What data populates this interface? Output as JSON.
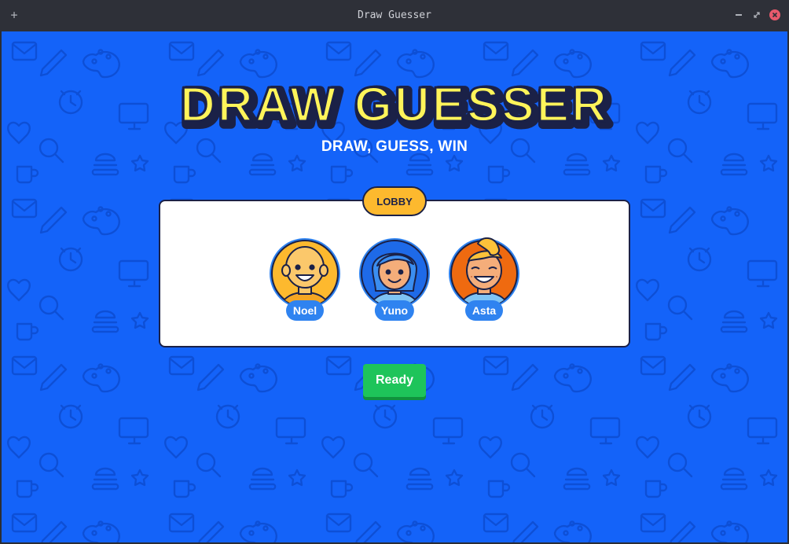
{
  "window": {
    "title": "Draw Guesser",
    "controls": [
      "add-icon",
      "minimize-icon",
      "maximize-icon",
      "close-icon"
    ]
  },
  "app": {
    "logo_text": "DRAW GUESSER",
    "tagline": "DRAW, GUESS, WIN",
    "colors": {
      "background": "#1463f9",
      "logo_fill": "#fff45a",
      "logo_outline": "#1b2147",
      "badge": "#fdb92e",
      "ready": "#1ec45a",
      "name_tag": "#2f83f0"
    }
  },
  "lobby": {
    "label": "LOBBY",
    "players": [
      {
        "name": "Noel",
        "avatar": "bald-boy-avatar"
      },
      {
        "name": "Yuno",
        "avatar": "blue-hair-avatar"
      },
      {
        "name": "Asta",
        "avatar": "blonde-boy-avatar"
      }
    ]
  },
  "actions": {
    "ready_label": "Ready"
  }
}
